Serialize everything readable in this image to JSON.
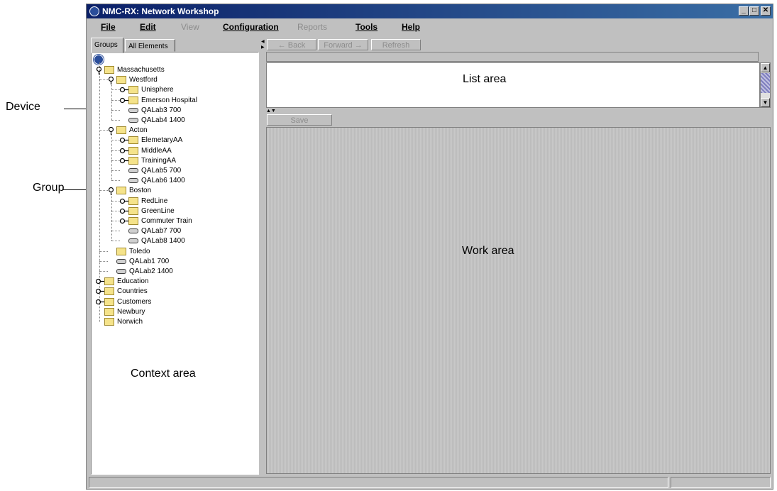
{
  "callouts": {
    "device": "Device",
    "group": "Group"
  },
  "window": {
    "title": "NMC-RX: Network Workshop"
  },
  "menu": {
    "file": "File",
    "edit": "Edit",
    "view": "View",
    "configuration": "Configuration",
    "reports": "Reports",
    "tools": "Tools",
    "help": "Help"
  },
  "tabs": {
    "groups": "Groups",
    "all_elements": "All Elements"
  },
  "tree": [
    {
      "label": "Massachusetts",
      "type": "folder",
      "expanded": true
    },
    {
      "label": "Westford",
      "type": "folder",
      "expanded": true
    },
    {
      "label": "Unisphere",
      "type": "folder",
      "expanded": false
    },
    {
      "label": "Emerson Hospital",
      "type": "folder",
      "expanded": false
    },
    {
      "label": "QALab3 700",
      "type": "device"
    },
    {
      "label": "QALab4 1400",
      "type": "device"
    },
    {
      "label": "Acton",
      "type": "folder",
      "expanded": true
    },
    {
      "label": "ElemetaryAA",
      "type": "folder",
      "expanded": false
    },
    {
      "label": "MiddleAA",
      "type": "folder",
      "expanded": false
    },
    {
      "label": "TrainingAA",
      "type": "folder",
      "expanded": false
    },
    {
      "label": "QALab5 700",
      "type": "device"
    },
    {
      "label": "QALab6 1400",
      "type": "device"
    },
    {
      "label": "Boston",
      "type": "folder",
      "expanded": true
    },
    {
      "label": "RedLine",
      "type": "folder",
      "expanded": false
    },
    {
      "label": "GreenLine",
      "type": "folder",
      "expanded": false
    },
    {
      "label": "Commuter Train",
      "type": "folder",
      "expanded": false
    },
    {
      "label": "QALab7 700",
      "type": "device"
    },
    {
      "label": "QALab8 1400",
      "type": "device"
    },
    {
      "label": "Toledo",
      "type": "folder"
    },
    {
      "label": "QALab1 700",
      "type": "device"
    },
    {
      "label": "QALab2 1400",
      "type": "device"
    },
    {
      "label": "Education",
      "type": "folder",
      "expanded": false
    },
    {
      "label": "Countries",
      "type": "folder",
      "expanded": false
    },
    {
      "label": "Customers",
      "type": "folder",
      "expanded": false
    },
    {
      "label": "Newbury",
      "type": "folder"
    },
    {
      "label": "Norwich",
      "type": "folder"
    }
  ],
  "areas": {
    "context": "Context area",
    "list": "List area",
    "work": "Work area"
  },
  "nav": {
    "back": "← Back",
    "forward": "Forward →",
    "refresh": "Refresh"
  },
  "work": {
    "save": "Save"
  },
  "colors": {
    "titlebar": "#0b2068",
    "folder": "#f5e38a",
    "window": "#c0c0c0"
  },
  "icons": {
    "folder": "folder-icon",
    "device": "device-icon",
    "expanded": "expanded-icon",
    "collapsed": "collapsed-icon"
  }
}
